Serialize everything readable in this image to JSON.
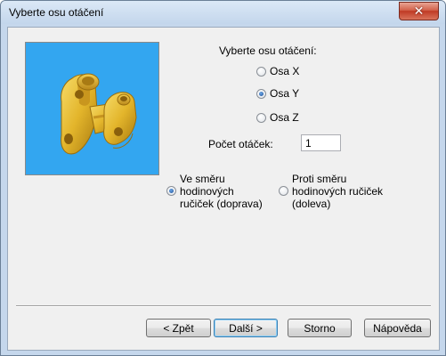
{
  "window": {
    "title": "Vyberte osu otáčení"
  },
  "prompt": "Vyberte osu otáčení:",
  "axes": [
    {
      "label": "Osa X",
      "checked": false
    },
    {
      "label": "Osa Y",
      "checked": true
    },
    {
      "label": "Osa Z",
      "checked": false
    }
  ],
  "count": {
    "label": "Počet otáček:",
    "value": "1"
  },
  "directions": [
    {
      "label": "Ve směru\nhodinových\nručiček (doprava)",
      "checked": true
    },
    {
      "label": "Proti směru\nhodinových ručiček\n(doleva)",
      "checked": false
    }
  ],
  "buttons": {
    "back": "< Zpět",
    "next": "Další >",
    "cancel": "Storno",
    "help": "Nápověda"
  },
  "colors": {
    "preview_bg": "#33a6f0",
    "part": "#e3b52b"
  }
}
